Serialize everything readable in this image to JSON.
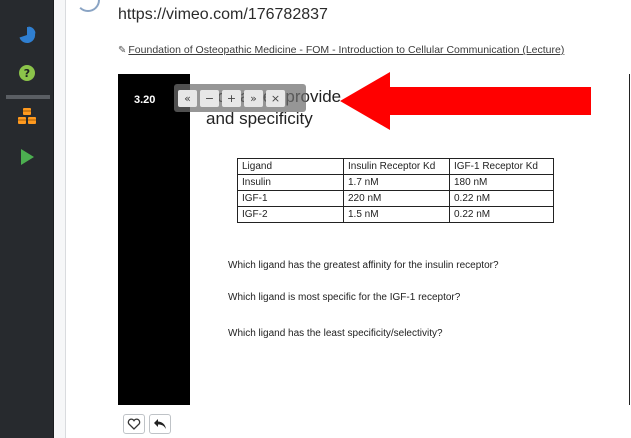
{
  "sidebar": {
    "items": [
      {
        "name": "pie-chart-icon",
        "color": "#2f7fd1"
      },
      {
        "name": "help-icon",
        "color": "#8bc34a"
      },
      {
        "name": "cubes-icon",
        "color": "#ff9a1f"
      },
      {
        "name": "play-icon",
        "color": "#4caf50"
      }
    ]
  },
  "header": {
    "url": "https://vimeo.com/176782837",
    "lecture_link": "Foundation of Osteopathic Medicine - FOM - Introduction to Cellular Communication (Lecture)",
    "link_icon": "external-link-icon"
  },
  "slide": {
    "number": "3.20",
    "title_line1": "Kd values provide",
    "title_line2": "and specificity",
    "table": {
      "headers": [
        "Ligand",
        "Insulin Receptor Kd",
        "IGF-1 Receptor Kd"
      ],
      "rows": [
        [
          "Insulin",
          "1.7 nM",
          "180 nM"
        ],
        [
          "IGF-1",
          "220 nM",
          "0.22 nM"
        ],
        [
          "IGF-2",
          "1.5  nM",
          "0.22  nM"
        ]
      ]
    },
    "questions": [
      "Which ligand has the greatest affinity for the insulin receptor?",
      "Which ligand is most specific for the IGF-1 receptor?",
      "Which ligand has the least specificity/selectivity?"
    ]
  },
  "controls": {
    "buttons": [
      {
        "name": "rewind-button",
        "glyph": "«"
      },
      {
        "name": "minus-button",
        "glyph": "−"
      },
      {
        "name": "plus-button",
        "glyph": "+"
      },
      {
        "name": "forward-button",
        "glyph": "»"
      },
      {
        "name": "close-button",
        "glyph": "×"
      }
    ]
  },
  "annotation": {
    "arrow_color": "#ff0000"
  },
  "actions": {
    "like_icon": "heart-icon",
    "reply_icon": "reply-icon"
  }
}
